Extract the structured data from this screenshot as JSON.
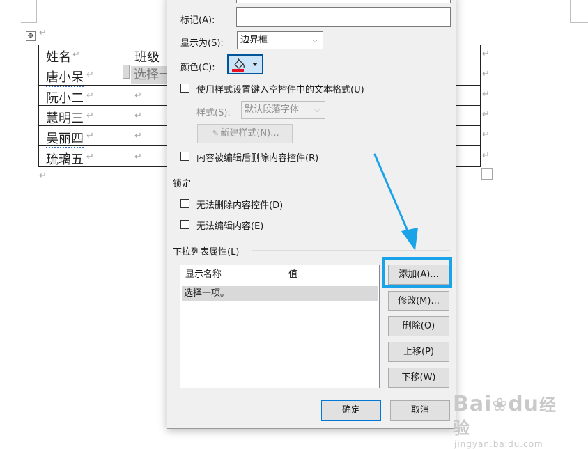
{
  "doc": {
    "header": "姓名",
    "header2": "班级",
    "rows": [
      "唐小呆",
      "阮小二",
      "慧明三",
      "吴丽四",
      "琉璃五"
    ],
    "cc_placeholder": "选择一项",
    "para": "↵",
    "move_glyph": "✥"
  },
  "dialog": {
    "tag_label": "标记(A):",
    "show_as_label": "显示为(S):",
    "show_as_value": "边界框",
    "color_label": "颜色(C):",
    "use_style_label": "使用样式设置键入空控件中的文本格式(U)",
    "style_label": "样式(S):",
    "style_value": "默认段落字体",
    "new_style_btn": "新建样式(N)...",
    "remove_cc_label": "内容被编辑后删除内容控件(R)",
    "lock_group": "锁定",
    "cant_delete_label": "无法删除内容控件(D)",
    "cant_edit_label": "无法编辑内容(E)",
    "dropdown_group": "下拉列表属性(L)",
    "col_display_name": "显示名称",
    "col_value": "值",
    "list_items": [
      {
        "name": "选择一项。",
        "value": ""
      }
    ],
    "add_btn": "添加(A)...",
    "modify_btn": "修改(M)...",
    "delete_btn": "删除(O)",
    "move_up_btn": "上移(P)",
    "move_down_btn": "下移(W)",
    "ok_btn": "确定",
    "cancel_btn": "取消"
  },
  "colors": {
    "highlight": "#1aa3e8",
    "arrow": "#1aa3e8",
    "color_swatch": "#e81123"
  },
  "watermark": {
    "brand": "Bai",
    "brand2": "du",
    "brand_cn": "经验",
    "url": "jingyan.baidu.com"
  }
}
